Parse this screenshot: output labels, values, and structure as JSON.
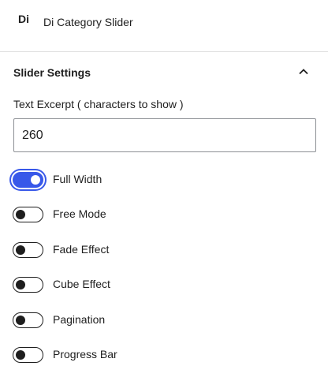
{
  "block": {
    "icon_text": "Di",
    "title": "Di Category Slider"
  },
  "section": {
    "title": "Slider Settings",
    "expanded": true
  },
  "excerpt": {
    "label": "Text Excerpt ( characters to show )",
    "value": "260"
  },
  "toggles": [
    {
      "label": "Full Width",
      "checked": true
    },
    {
      "label": "Free Mode",
      "checked": false
    },
    {
      "label": "Fade Effect",
      "checked": false
    },
    {
      "label": "Cube Effect",
      "checked": false
    },
    {
      "label": "Pagination",
      "checked": false
    },
    {
      "label": "Progress Bar",
      "checked": false
    }
  ],
  "colors": {
    "accent": "#3858e9",
    "text": "#1e1e1e",
    "divider": "#e0e0e0"
  }
}
